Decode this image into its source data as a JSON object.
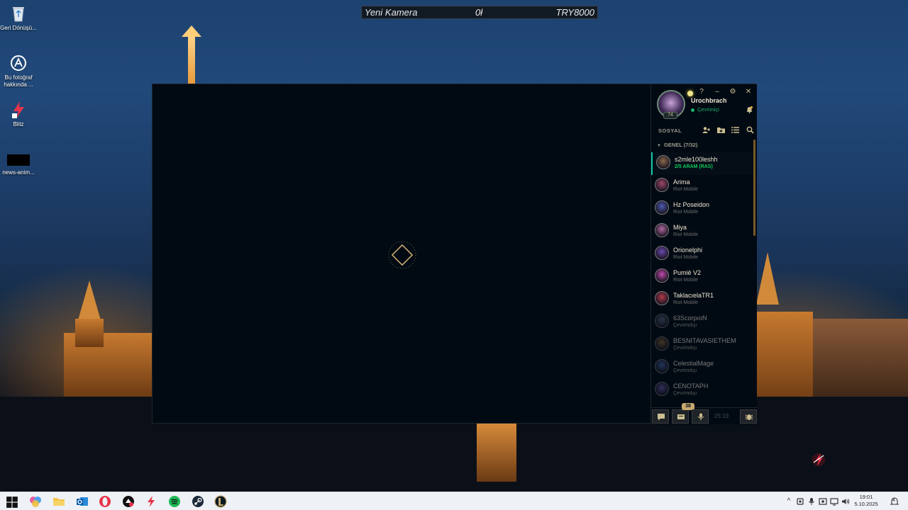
{
  "desktop": {
    "icons": [
      {
        "label": "Geri Dönüşü...",
        "icon": "recycle-bin-icon"
      },
      {
        "label": "Bu fotoğraf hakkında ...",
        "icon": "about-photo-icon"
      },
      {
        "label": "Blitz",
        "icon": "blitz-icon"
      },
      {
        "label": "news-anim...",
        "icon": "video-file-icon"
      }
    ]
  },
  "topbar": {
    "camera": "Yeni Kamera",
    "value": "0ł",
    "currency": "TRY8000"
  },
  "social": {
    "username": "Urochbrach",
    "status": "Çevrimiçi",
    "level": "74",
    "section_title": "SOSYAL",
    "group_header": "GENEL (7/32)",
    "window_controls": [
      "?",
      "–",
      "⚙",
      "✕"
    ],
    "friends": [
      {
        "name": "s2mle100leshh",
        "status": "2/5 ARAM (RAS)",
        "state": "ingame",
        "avatar_color": "#8a6a4a"
      },
      {
        "name": "Arima",
        "status": "Riot Mobile",
        "state": "mobile",
        "avatar_color": "#a04a6a"
      },
      {
        "name": "Hz Poseidon",
        "status": "Riot Mobile",
        "state": "mobile",
        "avatar_color": "#4a5ab0"
      },
      {
        "name": "Miya",
        "status": "Riot Mobile",
        "state": "mobile",
        "avatar_color": "#b06aa0"
      },
      {
        "name": "Orionelphi",
        "status": "Riot Mobile",
        "state": "mobile",
        "avatar_color": "#6a4ab0"
      },
      {
        "name": "Pumië V2",
        "status": "Riot Mobile",
        "state": "mobile",
        "avatar_color": "#c04ab0"
      },
      {
        "name": "TaklacıelaTR1",
        "status": "Riot Mobile",
        "state": "mobile",
        "avatar_color": "#b03a4a"
      },
      {
        "name": "63ScorpıoN",
        "status": "Çevrimdışı",
        "state": "offline",
        "avatar_color": "#5a6a8a"
      },
      {
        "name": "BESNITAVASIETHEM",
        "status": "Çevrimdışı",
        "state": "offline",
        "avatar_color": "#8a6a3a"
      },
      {
        "name": "CelestialMage",
        "status": "Çevrimdışı",
        "state": "offline",
        "avatar_color": "#4a6ab0"
      },
      {
        "name": "CENOTAPH",
        "status": "Çevrimdışı",
        "state": "offline",
        "avatar_color": "#6a5ab0"
      }
    ],
    "bottom_bar": {
      "badge_count": "38",
      "time": "25:19"
    }
  },
  "taskbar": {
    "time": "19:01",
    "date": "5.10.2025",
    "notification_count": "4"
  },
  "colors": {
    "accent_gold": "#c8aa6e",
    "online_green": "#1fb36b",
    "client_bg": "#010a13"
  }
}
